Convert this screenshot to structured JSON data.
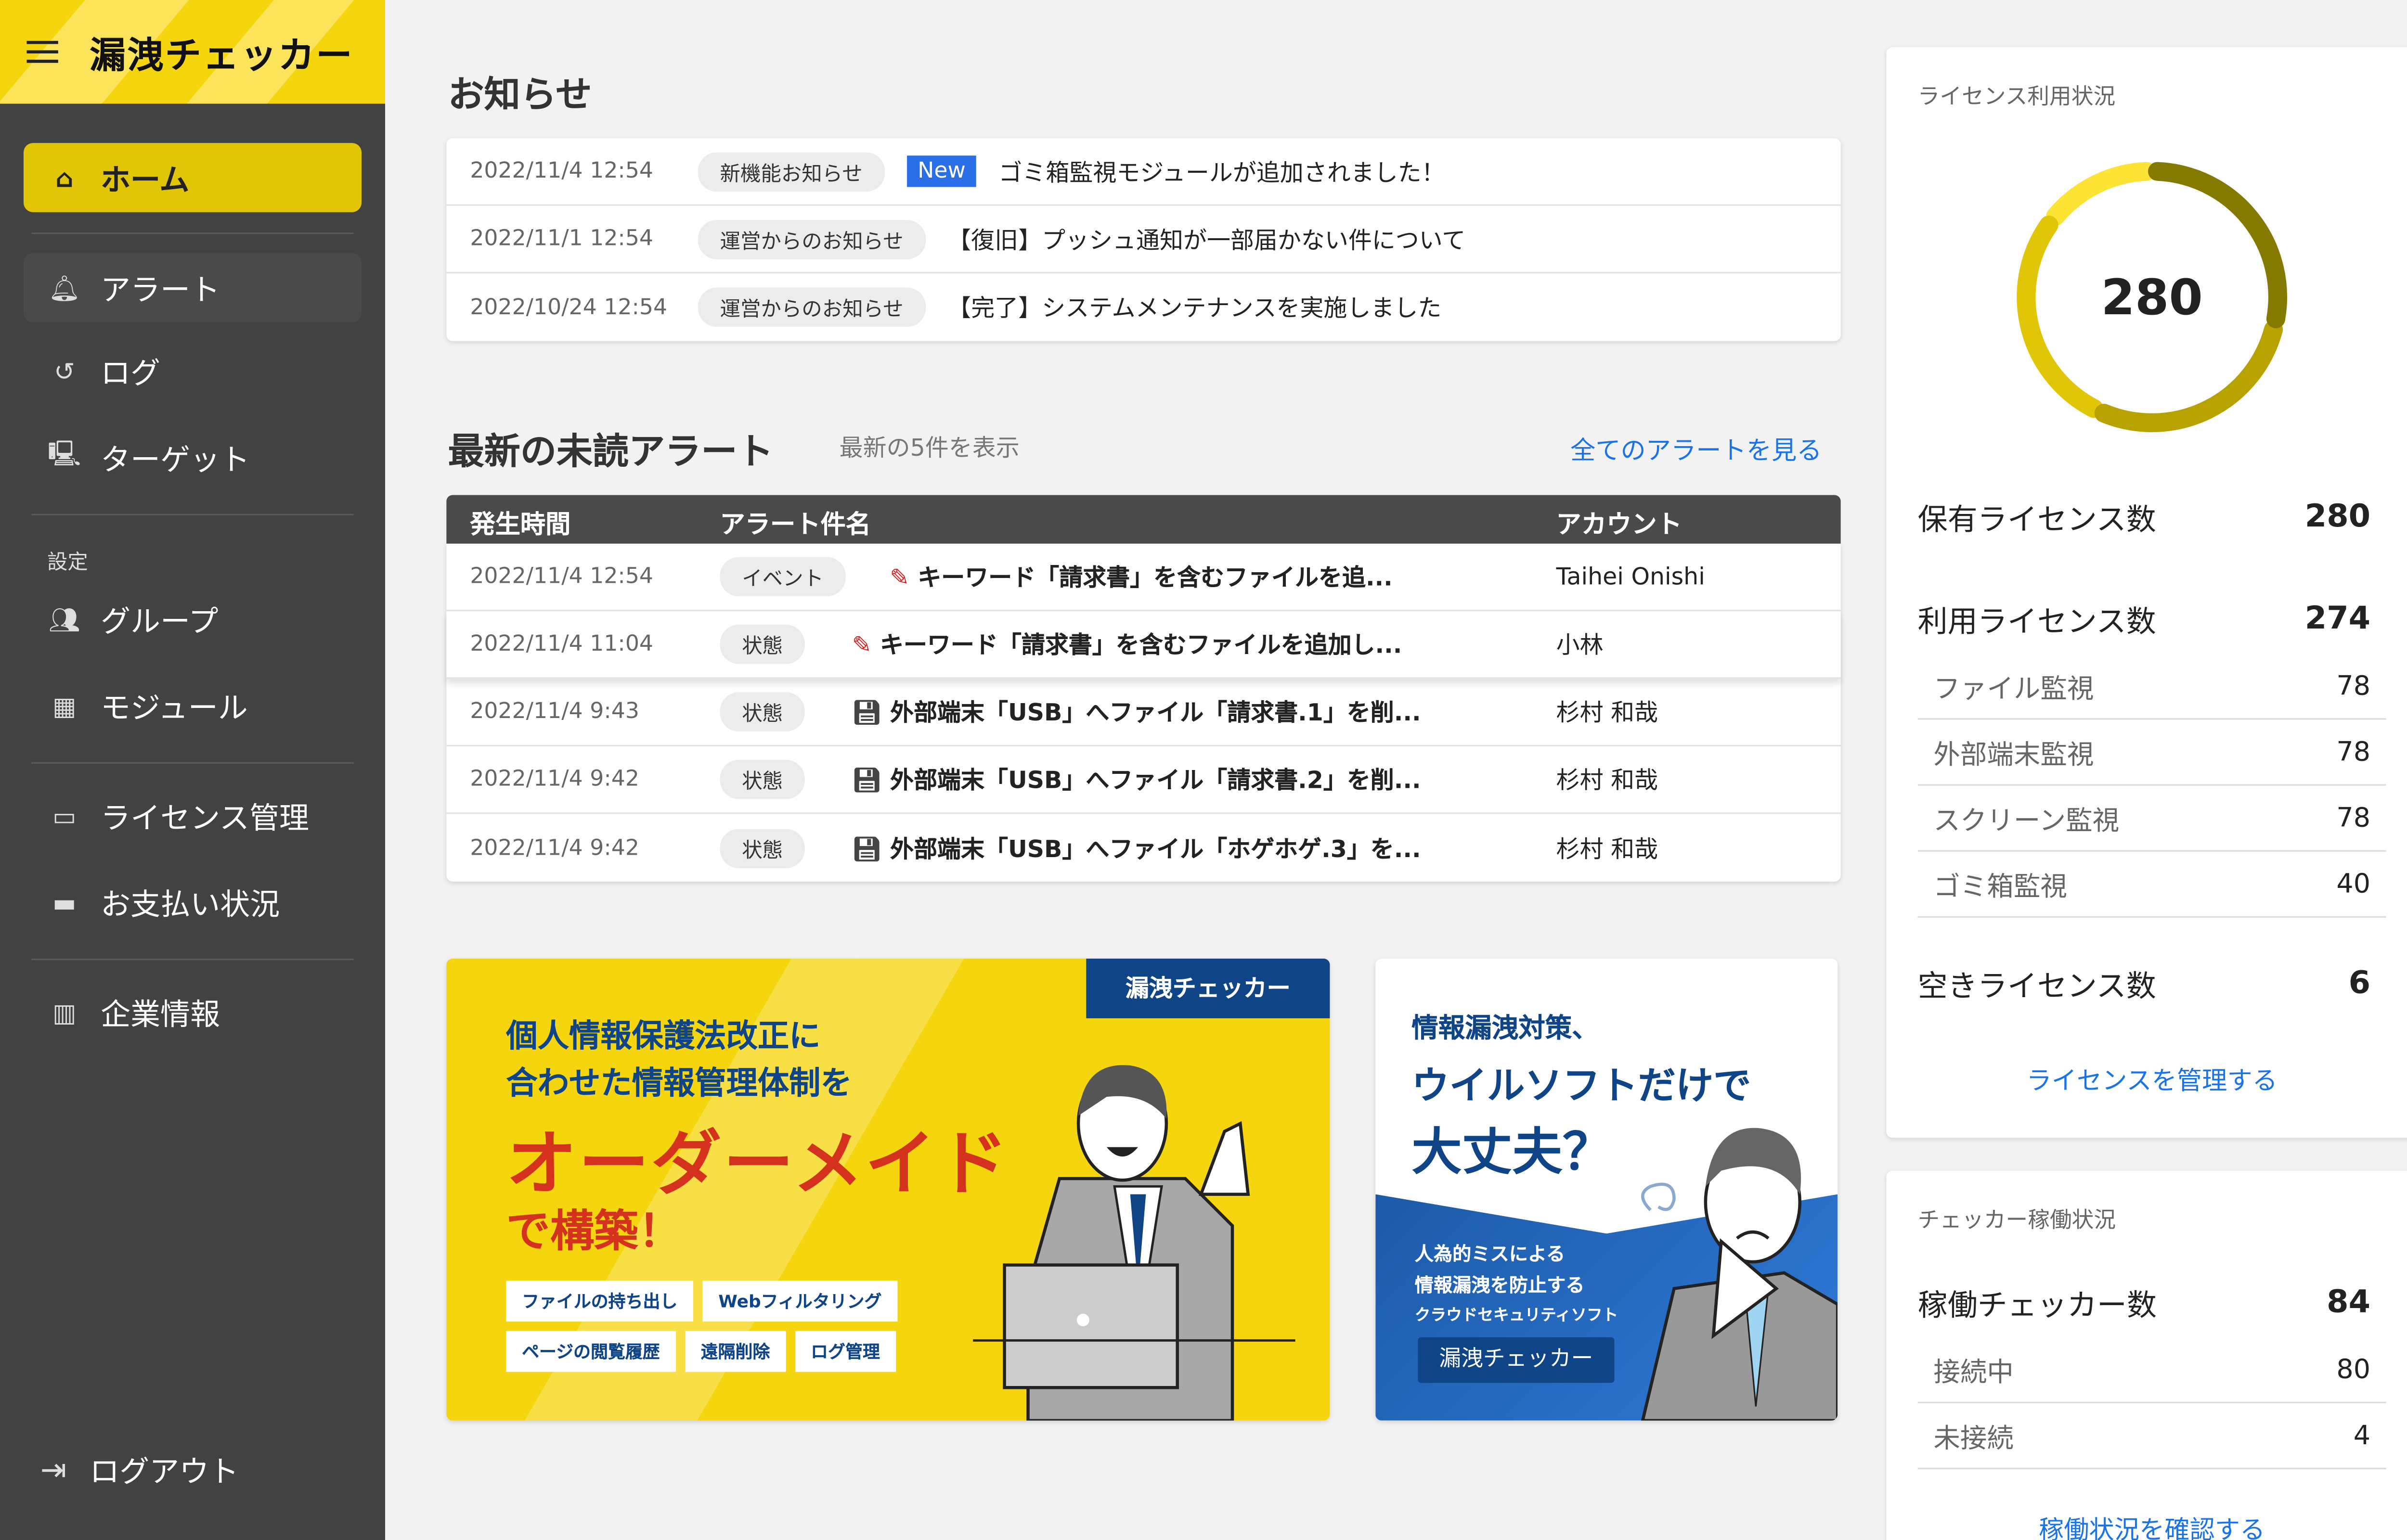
{
  "app": {
    "title": "漏洩チェッカー"
  },
  "sidebar": {
    "items": [
      {
        "label": "ホーム",
        "icon": "home-icon"
      },
      {
        "label": "アラート",
        "icon": "bell-alert-icon"
      },
      {
        "label": "ログ",
        "icon": "history-icon"
      },
      {
        "label": "ターゲット",
        "icon": "computer-user-icon"
      },
      {
        "label": "グループ",
        "icon": "group-icon"
      },
      {
        "label": "モジュール",
        "icon": "module-grid-icon"
      },
      {
        "label": "ライセンス管理",
        "icon": "license-icon"
      },
      {
        "label": "お支払い状況",
        "icon": "credit-card-icon"
      },
      {
        "label": "企業情報",
        "icon": "building-icon"
      }
    ],
    "settings_label": "設定",
    "logout": "ログアウト"
  },
  "notices": {
    "title": "お知らせ",
    "new_badge": "New",
    "rows": [
      {
        "date": "2022/11/4 12:54",
        "category": "新機能お知らせ",
        "is_new": true,
        "text": "ゴミ箱監視モジュールが追加されました！"
      },
      {
        "date": "2022/11/1 12:54",
        "category": "運営からのお知らせ",
        "is_new": false,
        "text": "【復旧】プッシュ通知が一部届かない件について"
      },
      {
        "date": "2022/10/24 12:54",
        "category": "運営からのお知らせ",
        "is_new": false,
        "text": "【完了】システムメンテナンスを実施しました"
      }
    ]
  },
  "alerts": {
    "title": "最新の未読アラート",
    "subtitle": "最新の5件を表示",
    "view_all": "全てのアラートを見る",
    "columns": [
      "発生時間",
      "アラート件名",
      "アカウント"
    ],
    "rows": [
      {
        "time": "2022/11/4 12:54",
        "type": "イベント",
        "icon": "pencil-icon",
        "name": "キーワード「請求書」を含むファイルを追...",
        "account": "Taihei Onishi"
      },
      {
        "time": "2022/11/4 11:04",
        "type": "状態",
        "icon": "pencil-icon",
        "name": "キーワード「請求書」を含むファイルを追加し...",
        "account": "小林"
      },
      {
        "time": "2022/11/4 9:43",
        "type": "状態",
        "icon": "floppy-disk-icon",
        "name": "外部端末「USB」へファイル「請求書.1」を削...",
        "account": "杉村 和哉"
      },
      {
        "time": "2022/11/4 9:42",
        "type": "状態",
        "icon": "floppy-disk-icon",
        "name": "外部端末「USB」へファイル「請求書.2」を削...",
        "account": "杉村 和哉"
      },
      {
        "time": "2022/11/4 9:42",
        "type": "状態",
        "icon": "floppy-disk-icon",
        "name": "外部端末「USB」へファイル「ホゲホゲ.3」を...",
        "account": "杉村 和哉"
      }
    ]
  },
  "banner1": {
    "brand": "漏洩チェッカー",
    "line1": "個人情報保護法改正に",
    "line2": "合わせた情報管理体制を",
    "headline": "オーダーメイド",
    "line3": "で構築！",
    "tags": [
      "ファイルの持ち出し",
      "Webフィルタリング",
      "ページの閲覧履歴",
      "遠隔削除",
      "ログ管理"
    ]
  },
  "banner2": {
    "line1": "情報漏洩対策、",
    "line2": "ウイルソフトだけで",
    "line3": "大丈夫？",
    "sub1": "人為的ミスによる",
    "sub2": "情報漏洩を防止する",
    "sub3": "クラウドセキュリティソフト",
    "brand": "漏洩チェッカー"
  },
  "license": {
    "title": "ライセンス利用状況",
    "donut_total": "280",
    "owned_label": "保有ライセンス数",
    "owned": "280",
    "used_label": "利用ライセンス数",
    "used": "274",
    "modules": [
      {
        "label": "ファイル監視",
        "value": "78",
        "color": "#857a00"
      },
      {
        "label": "外部端末監視",
        "value": "78",
        "color": "#b8a200"
      },
      {
        "label": "スクリーン監視",
        "value": "78",
        "color": "#e0c607"
      },
      {
        "label": "ゴミ箱監視",
        "value": "40",
        "color": "#fde333"
      }
    ],
    "free_label": "空きライセンス数",
    "free": "6",
    "manage_link": "ライセンスを管理する"
  },
  "checker": {
    "title": "チェッカー稼働状況",
    "running_label": "稼働チェッカー数",
    "running": "84",
    "rows": [
      {
        "label": "接続中",
        "value": "80"
      },
      {
        "label": "未接続",
        "value": "4"
      }
    ],
    "link": "稼働状況を確認する"
  },
  "colors": {
    "accent": "#f5d60e",
    "sidebar": "#424242",
    "link": "#1a73e8",
    "new_badge": "#2a6fe8",
    "banner_navy": "#0f4487",
    "banner_red": "#d4321c"
  }
}
